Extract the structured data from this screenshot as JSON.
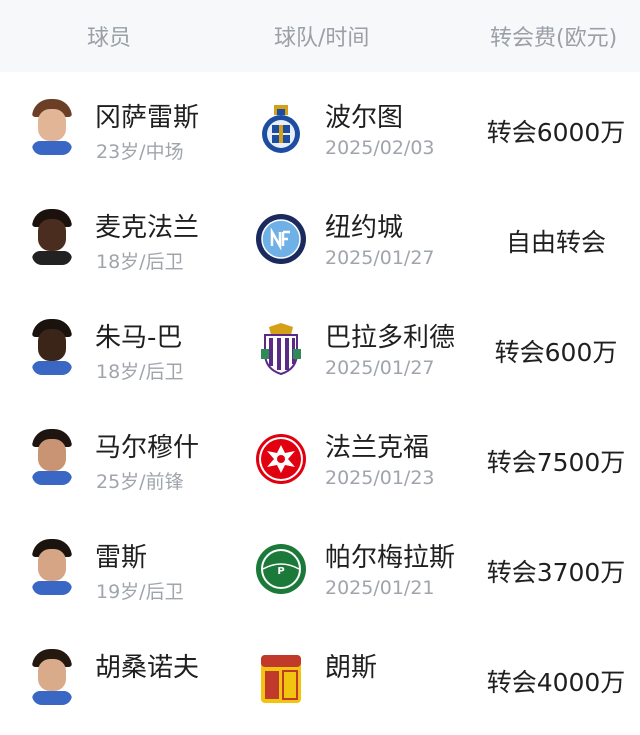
{
  "header": {
    "player": "球员",
    "team_time": "球队/时间",
    "fee": "转会费(欧元)"
  },
  "rows": [
    {
      "name": "冈萨雷斯",
      "info": "23岁/中场",
      "team": "波尔图",
      "date": "2025/02/03",
      "fee": "转会6000万",
      "badge": "porto-badge-icon"
    },
    {
      "name": "麦克法兰",
      "info": "18岁/后卫",
      "team": "纽约城",
      "date": "2025/01/27",
      "fee": "自由转会",
      "badge": "nycfc-badge-icon"
    },
    {
      "name": "朱马-巴",
      "info": "18岁/后卫",
      "team": "巴拉多利德",
      "date": "2025/01/27",
      "fee": "转会600万",
      "badge": "valladolid-badge-icon"
    },
    {
      "name": "马尔穆什",
      "info": "25岁/前锋",
      "team": "法兰克福",
      "date": "2025/01/23",
      "fee": "转会7500万",
      "badge": "frankfurt-badge-icon"
    },
    {
      "name": "雷斯",
      "info": "19岁/后卫",
      "team": "帕尔梅拉斯",
      "date": "2025/01/21",
      "fee": "转会3700万",
      "badge": "palmeiras-badge-icon"
    },
    {
      "name": "胡桑诺夫",
      "info": "",
      "team": "朗斯",
      "date": "",
      "fee": "转会4000万",
      "badge": "lens-badge-icon"
    }
  ]
}
